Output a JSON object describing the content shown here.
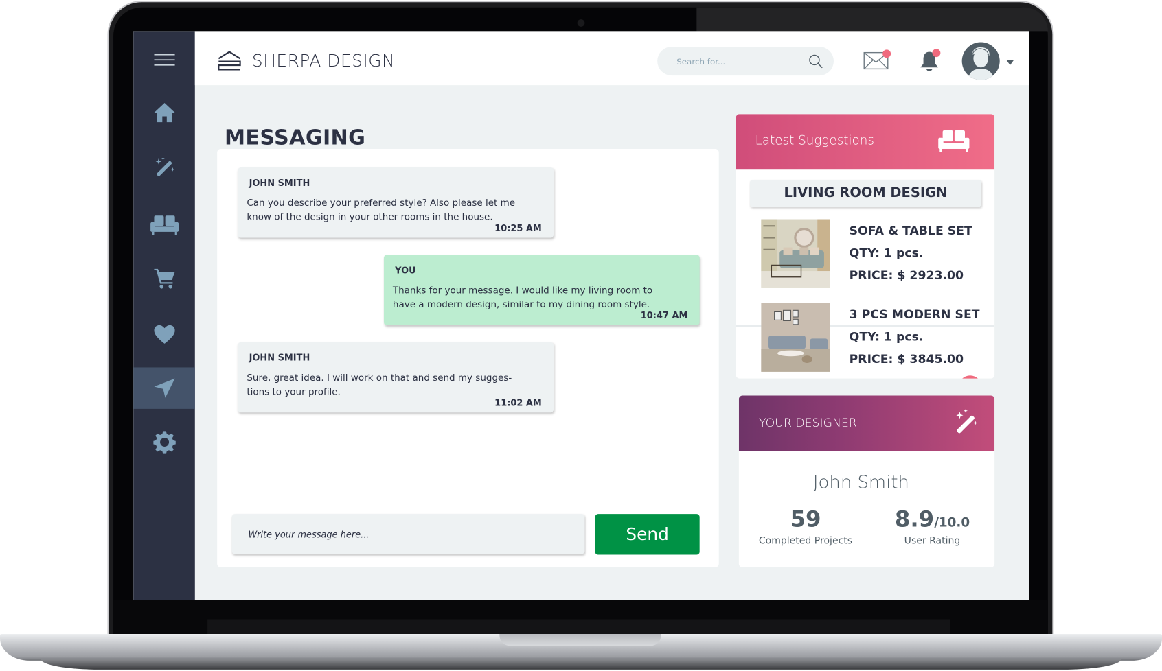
{
  "app": {
    "brand": "SHERPA DESIGN",
    "search_placeholder": "Search for...",
    "mail_unread": true,
    "notifications_unread": true
  },
  "sidebar": {
    "items": [
      {
        "id": "menu",
        "icon": "hamburger-menu-icon"
      },
      {
        "id": "home",
        "icon": "home-icon"
      },
      {
        "id": "design",
        "icon": "magic-wand-icon"
      },
      {
        "id": "furniture",
        "icon": "sofa-icon"
      },
      {
        "id": "cart",
        "icon": "cart-icon"
      },
      {
        "id": "favorites",
        "icon": "heart-icon"
      },
      {
        "id": "messaging",
        "icon": "send-icon",
        "active": true
      },
      {
        "id": "settings",
        "icon": "gear-icon"
      }
    ]
  },
  "page": {
    "title": "MESSAGING"
  },
  "messages": [
    {
      "sender": "JOHN SMITH",
      "text": "Can you describe your preferred style? Also please let me know of the design in your other rooms in the house.",
      "time": "10:25 AM",
      "from_me": false
    },
    {
      "sender": "YOU",
      "text": "Thanks for your message. I would like my living room to have a modern design, similar to my dining room style.",
      "time": "10:47 AM",
      "from_me": true
    },
    {
      "sender": "JOHN SMITH",
      "text": "Sure, great idea. I will work on that and send my sugges-tions to your profile.",
      "time": "11:02 AM",
      "from_me": false
    }
  ],
  "composer": {
    "placeholder": "Write your message here...",
    "value": "",
    "send_label": "Send"
  },
  "suggestions": {
    "title": "Latest Suggestions",
    "room": "LIVING ROOM DESIGN",
    "products": [
      {
        "name": "SOFA & TABLE SET",
        "qty": "QTY: 1 pcs.",
        "price": "PRICE: $ 2923.00"
      },
      {
        "name": "3 PCS MODERN SET",
        "qty": "QTY: 1 pcs.",
        "price": "PRICE: $ 3845.00"
      }
    ]
  },
  "designer": {
    "title": "YOUR DESIGNER",
    "name": "John Smith",
    "projects_value": "59",
    "projects_label": "Completed Projects",
    "rating_value": "8.9",
    "rating_scale": "/10.0",
    "rating_label": "User Rating"
  },
  "colors": {
    "sidebar": "#2c3143",
    "sidebar_active": "#44536a",
    "accent_pink": "#f06d88",
    "accent_purple": "#6e3468",
    "send_green": "#009245",
    "my_bubble": "#bcedd0",
    "badge": "#f06a7e"
  }
}
